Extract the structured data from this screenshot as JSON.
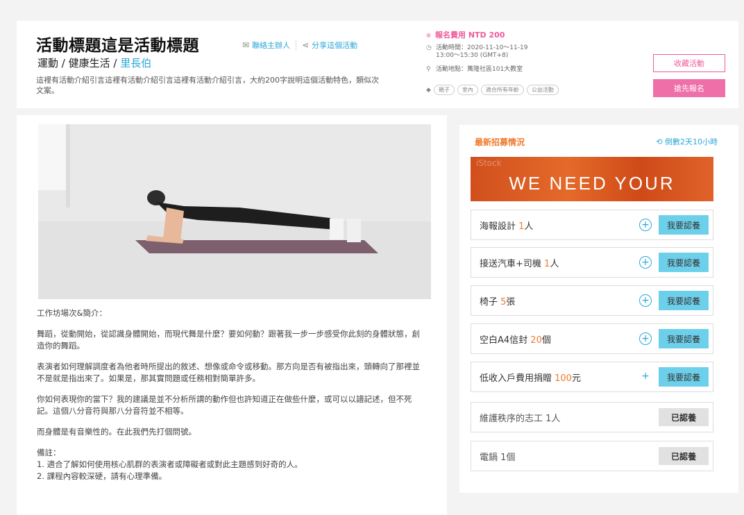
{
  "header": {
    "title": "活動標題這是活動標題",
    "breadcrumb": {
      "category": "運動 / 健康生活 / ",
      "organizer": "里長伯"
    },
    "intro": "這裡有活動介紹引言這裡有活動介紹引言這裡有活動介紹引言，大約200字說明這個活動特色，類似次文案。",
    "contact_label": "聯絡主辦人",
    "share_label": "分享這個活動",
    "fee": "報名費用 NTD 200",
    "time_label": "活動時間：2020-11-10～11-19",
    "time_range": "13:00～15:30 (GMT+8)",
    "location": "活動地點：萬隆社區101大教室",
    "tags": [
      "親子",
      "室內",
      "適合所有年齡",
      "公益活動"
    ],
    "save_label": "收藏活動",
    "register_label": "搶先報名"
  },
  "icons": {
    "mail": "mail-icon",
    "share": "share-icon",
    "fee": "dot-icon",
    "clock": "clock-icon",
    "pin": "location-pin-icon",
    "tag": "tag-icon",
    "countdown": "timer-icon",
    "plus": "plus-circle-icon"
  },
  "colors": {
    "accent_blue": "#2aa7d9",
    "accent_pink": "#ef5a9b",
    "accent_orange": "#f07a2d"
  },
  "description": {
    "heading": "工作坊場次&簡介：",
    "paragraphs": [
      "舞蹈，從動開始，從認識身體開始，而現代舞是什麼？要如何動？跟著我一步一步感受你此刻的身體狀態，創造你的舞蹈。",
      "表演者如何理解調度者為他者時所提出的敘述、想像或命令或移動。那方向是否有被指出來，頭轉向了那裡並不是就是指出來了。如果是，那其實問題或任務相對簡單許多。",
      "你如何表現你的當下？我的建議是並不分析所謂的動作但也許知道正在做些什麼，或可以以譜記述，但不死記。這個八分音符與那八分音符並不相等。",
      "而身體是有音樂性的。在此我們先打個問號。"
    ],
    "notes_title": "備註：",
    "notes": [
      "1. 適合了解如何使用核心肌群的表演者或障礙者或對此主題感到好奇的人。",
      "2. 課程內容較深硬，請有心理準備。"
    ]
  },
  "sidebar": {
    "title": "最新招募情況",
    "countdown": "倒數2天10小時",
    "banner_text": "WE NEED YOUR",
    "banner_watermark": "iStock",
    "adopt_label": "我要認養",
    "adopted_label": "已認養",
    "needs": [
      {
        "name": "海報設計 ",
        "qty": "1",
        "unit": "人"
      },
      {
        "name": "接送汽車+司機 ",
        "qty": "1",
        "unit": "人"
      },
      {
        "name": "椅子 ",
        "qty": "5",
        "unit": "張"
      },
      {
        "name": "空白A4信封 ",
        "qty": "20",
        "unit": "個"
      },
      {
        "name": "低收入戶費用捐贈 ",
        "qty": "100",
        "unit": "元"
      }
    ],
    "fulfilled": [
      {
        "text": "維護秩序的志工 1人"
      },
      {
        "text": "電鍋 1個"
      }
    ]
  }
}
